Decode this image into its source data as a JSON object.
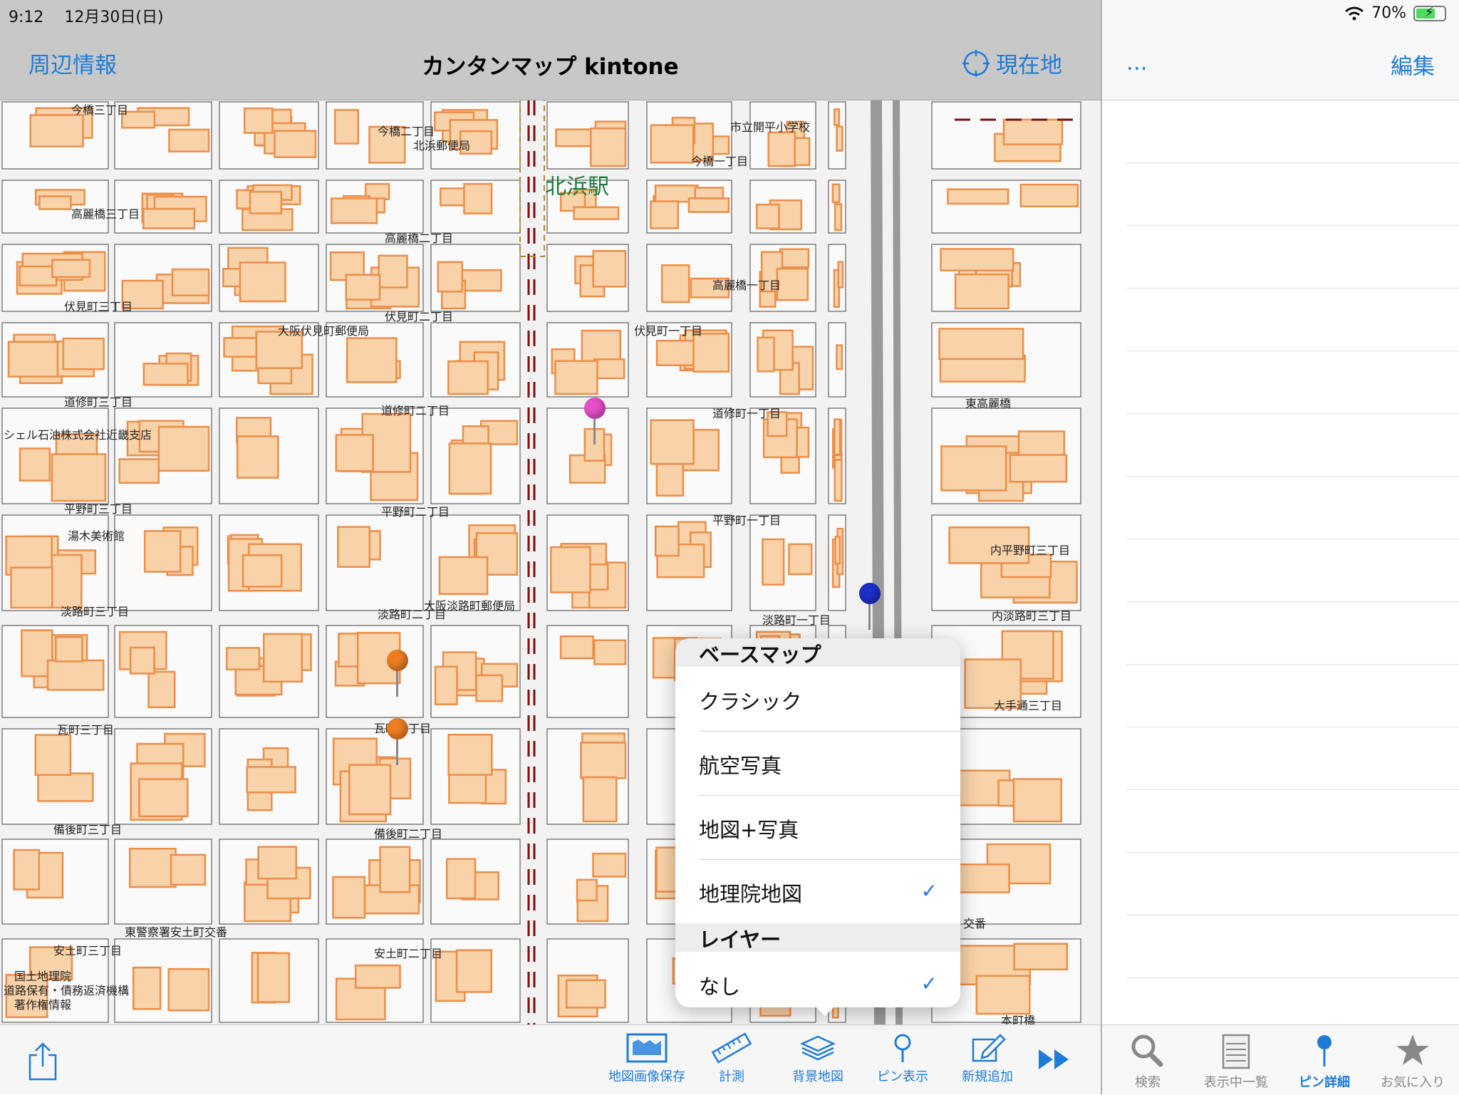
{
  "status": {
    "time": "9:12",
    "date": "12月30日(日)",
    "battery_pct": "70%"
  },
  "nav": {
    "left_button": "周辺情報",
    "title": "カンタンマップ kintone",
    "right_button": "現在地"
  },
  "right_nav": {
    "more": "...",
    "edit": "編集"
  },
  "map": {
    "labels": [
      "北浜駅",
      "今橋三丁目",
      "今橋二丁目",
      "北浜郵便局",
      "今橋一丁目",
      "市立開平小学校",
      "高麗橋三丁目",
      "高麗橋二丁目",
      "高麗橋一丁目",
      "伏見町三丁目",
      "伏見町二丁目",
      "大阪伏見町郵便局",
      "伏見町一丁目",
      "道修町三丁目",
      "道修町二丁目",
      "道修町一丁目",
      "東高麗橋",
      "シェル石油株式会社近畿支店",
      "平野町三丁目",
      "平野町二丁目",
      "平野町一丁目",
      "湯木美術館",
      "内平野町三丁目",
      "大阪淡路町郵便局",
      "淡路町三丁目",
      "淡路町二丁目",
      "淡路町一丁目",
      "内淡路町三丁目",
      "大手通三丁目",
      "瓦町三丁目",
      "瓦町二丁目",
      "備後町三丁目",
      "備後町二丁目",
      "東警察署安土町交番",
      "安土町三丁目",
      "安土町二丁目",
      "国土地理院",
      "道路保有・債務返済機構",
      "著作権情報",
      "交番",
      "本町橋"
    ],
    "pins": [
      {
        "color": "#e64fc8"
      },
      {
        "color": "#1b2fc9"
      },
      {
        "color": "#ee7d22"
      },
      {
        "color": "#ee7d22"
      }
    ]
  },
  "popover": {
    "section_basemap": "ベースマップ",
    "basemap_options": [
      {
        "label": "クラシック",
        "checked": false
      },
      {
        "label": "航空写真",
        "checked": false
      },
      {
        "label": "地図+写真",
        "checked": false
      },
      {
        "label": "地理院地図",
        "checked": true
      }
    ],
    "section_layer": "レイヤー",
    "layer_options": [
      {
        "label": "なし",
        "checked": true
      }
    ],
    "check_mark": "✓"
  },
  "toolbar": {
    "items": [
      {
        "label": "地図画像保存",
        "icon": "map-save-icon"
      },
      {
        "label": "計測",
        "icon": "ruler-icon"
      },
      {
        "label": "背景地図",
        "icon": "layers-icon"
      },
      {
        "label": "ピン表示",
        "icon": "pin-icon"
      },
      {
        "label": "新規追加",
        "icon": "compose-icon"
      }
    ]
  },
  "tabbar": {
    "items": [
      {
        "label": "検索",
        "icon": "search-icon",
        "active": false
      },
      {
        "label": "表示中一覧",
        "icon": "list-icon",
        "active": false
      },
      {
        "label": "ピン詳細",
        "icon": "pin-icon",
        "active": true
      },
      {
        "label": "お気に入り",
        "icon": "star-icon",
        "active": false
      }
    ]
  },
  "colors": {
    "accent": "#1f7bd8",
    "building_fill": "#f8d2a8",
    "building_stroke": "#ec8e4a",
    "station_label": "#1a7a3a"
  }
}
